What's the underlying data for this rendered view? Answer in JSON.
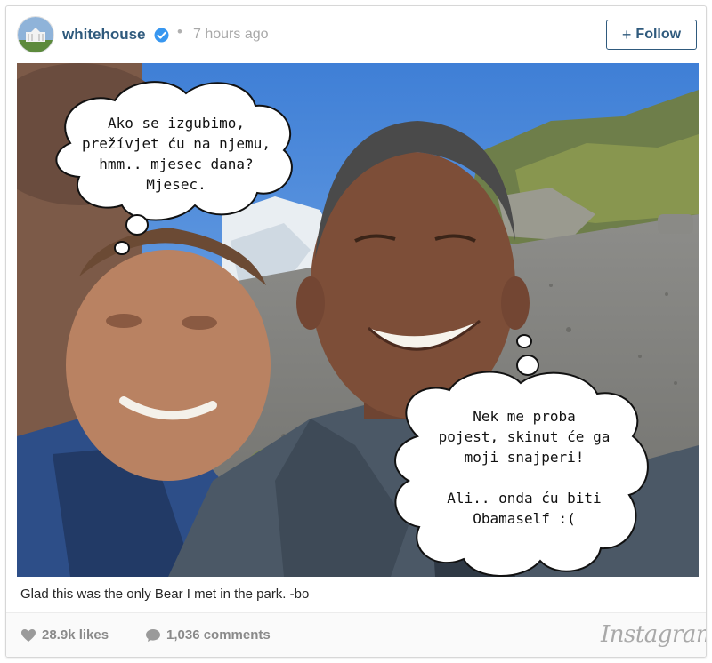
{
  "post": {
    "username": "whitehouse",
    "separator": "•",
    "time": "7 hours ago",
    "follow_label": "Follow",
    "follow_plus": "+",
    "accent_color": "#2f5a7d"
  },
  "photo": {
    "bubble_left": "Ako se izgubimo,\nprežívjet ću na njemu,\nhmm.. mjesec dana?\nMjesec.",
    "bubble_right": "Nek me proba\npojest, skinut će ga\nmoji snajperi!\n\nAli.. onda ću biti\nObamaself :("
  },
  "caption": "Glad this was the only Bear I met in the park. -bo",
  "footer": {
    "likes": "28.9k likes",
    "comments": "1,036 comments",
    "brand": "Instagram"
  },
  "icons": {
    "verified": "verified-badge-icon",
    "heart": "heart-icon",
    "comment": "comment-bubble-icon"
  }
}
